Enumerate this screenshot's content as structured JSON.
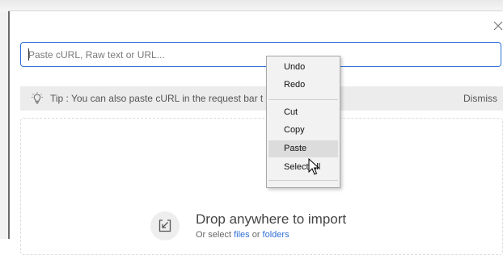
{
  "dialog": {
    "input": {
      "placeholder": "Paste cURL, Raw text or URL..."
    },
    "tip": {
      "text": "Tip : You can also paste cURL in the request bar t",
      "dismiss_label": "Dismiss",
      "icon": "lightbulb-icon"
    },
    "drop": {
      "title": "Drop anywhere to import",
      "prefix": "Or select",
      "files_label": "files",
      "or_label": "or",
      "folders_label": "folders",
      "icon": "import-icon"
    },
    "close_icon": "close-icon"
  },
  "context_menu": {
    "items": [
      {
        "label": "Undo"
      },
      {
        "label": "Redo"
      },
      {
        "label": "Cut"
      },
      {
        "label": "Copy"
      },
      {
        "label": "Paste",
        "highlighted": true
      },
      {
        "label": "Select All"
      }
    ]
  },
  "colors": {
    "accent": "#2f6fd6",
    "tip_background": "#ececec",
    "menu_background": "#f2f2f2"
  }
}
